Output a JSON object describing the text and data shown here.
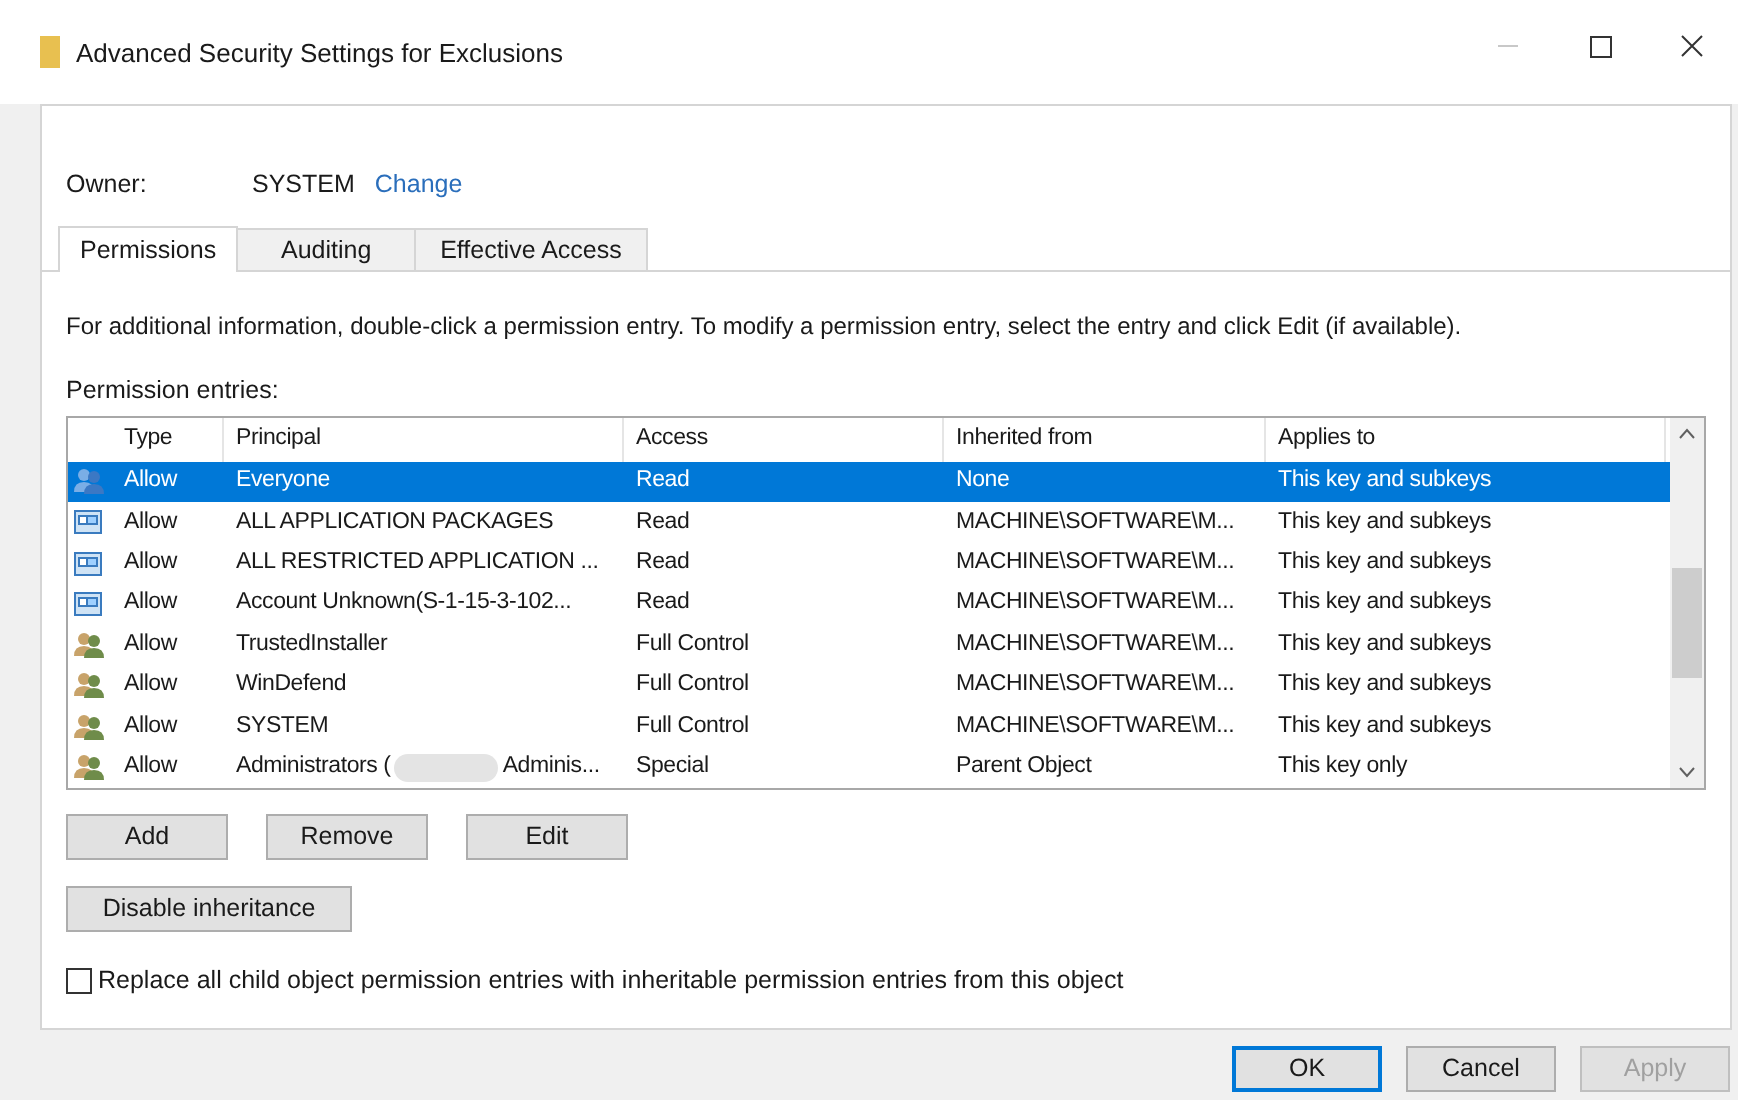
{
  "window": {
    "title": "Advanced Security Settings for Exclusions"
  },
  "owner": {
    "label": "Owner:",
    "value": "SYSTEM",
    "link": "Change"
  },
  "tabs": [
    {
      "label": "Permissions",
      "selected": true
    },
    {
      "label": "Auditing",
      "selected": false
    },
    {
      "label": "Effective Access",
      "selected": false
    }
  ],
  "info_text": "For additional information, double-click a permission entry. To modify a permission entry, select the entry and click Edit (if available).",
  "entries_label": "Permission entries:",
  "table": {
    "columns": [
      "Type",
      "Principal",
      "Access",
      "Inherited from",
      "Applies to"
    ],
    "rows": [
      {
        "kind": "group",
        "selected": true,
        "type": "Allow",
        "principal": "Everyone",
        "access": "Read",
        "inherited_from": "None",
        "applies_to": "This key and subkeys"
      },
      {
        "kind": "package",
        "selected": false,
        "type": "Allow",
        "principal": "ALL APPLICATION PACKAGES",
        "access": "Read",
        "inherited_from": "MACHINE\\SOFTWARE\\M...",
        "applies_to": "This key and subkeys"
      },
      {
        "kind": "package",
        "selected": false,
        "type": "Allow",
        "principal": "ALL RESTRICTED APPLICATION ...",
        "access": "Read",
        "inherited_from": "MACHINE\\SOFTWARE\\M...",
        "applies_to": "This key and subkeys"
      },
      {
        "kind": "package",
        "selected": false,
        "type": "Allow",
        "principal": "Account Unknown(S-1-15-3-102...",
        "access": "Read",
        "inherited_from": "MACHINE\\SOFTWARE\\M...",
        "applies_to": "This key and subkeys"
      },
      {
        "kind": "user",
        "selected": false,
        "type": "Allow",
        "principal": "TrustedInstaller",
        "access": "Full Control",
        "inherited_from": "MACHINE\\SOFTWARE\\M...",
        "applies_to": "This key and subkeys"
      },
      {
        "kind": "user",
        "selected": false,
        "type": "Allow",
        "principal": "WinDefend",
        "access": "Full Control",
        "inherited_from": "MACHINE\\SOFTWARE\\M...",
        "applies_to": "This key and subkeys"
      },
      {
        "kind": "user",
        "selected": false,
        "type": "Allow",
        "principal": "SYSTEM",
        "access": "Full Control",
        "inherited_from": "MACHINE\\SOFTWARE\\M...",
        "applies_to": "This key and subkeys"
      },
      {
        "kind": "user",
        "selected": false,
        "type": "Allow",
        "principal": "Administrators (",
        "principal_tail": "Adminis...",
        "access": "Special",
        "inherited_from": "Parent Object",
        "applies_to": "This key only"
      }
    ]
  },
  "entry_buttons": [
    {
      "label": "Add",
      "disabled": false
    },
    {
      "label": "Remove",
      "disabled": false
    },
    {
      "label": "Edit",
      "disabled": false
    }
  ],
  "inheritance_button": "Disable inheritance",
  "replace_checkbox": {
    "label": "Replace all child object permission entries with inheritable permission entries from this object",
    "checked": false
  },
  "dialog_buttons": [
    {
      "label": "OK",
      "default": true,
      "disabled": false
    },
    {
      "label": "Cancel",
      "default": false,
      "disabled": false
    },
    {
      "label": "Apply",
      "default": false,
      "disabled": true
    }
  ]
}
